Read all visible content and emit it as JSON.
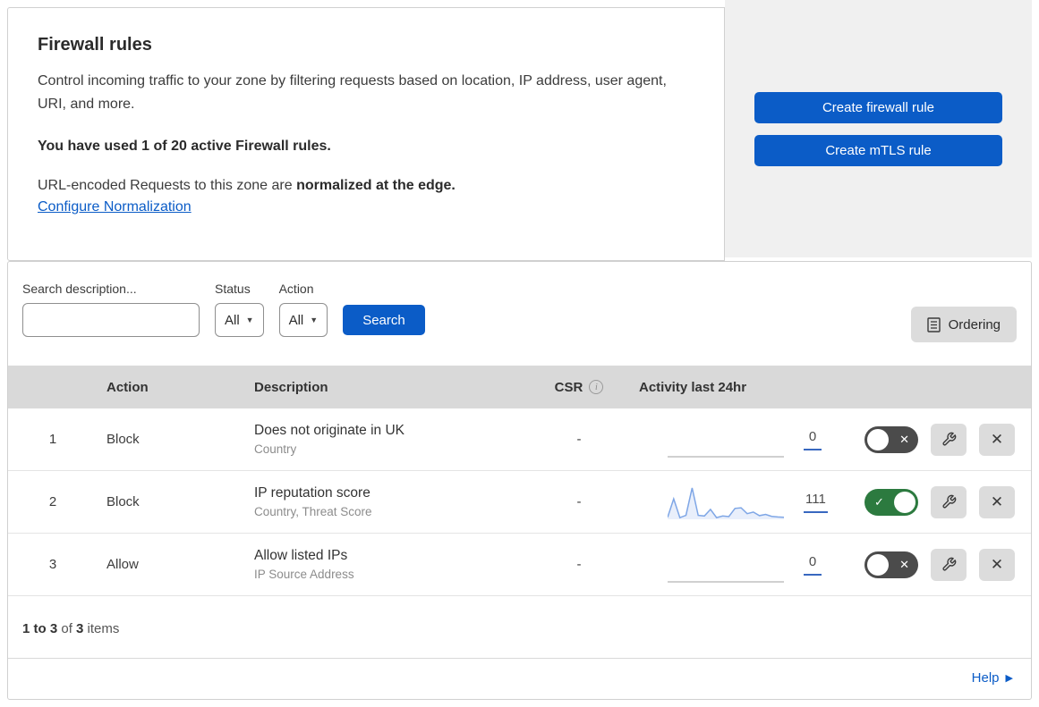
{
  "colors": {
    "primary_blue": "#0b5cc7",
    "panel_gray": "#f0f0f0",
    "table_header_gray": "#d9d9d9",
    "toggle_on_green": "#2c7a3f",
    "toggle_off_gray": "#4b4b4b",
    "sparkline_blue": "#7ea6e6",
    "count_underline_blue": "#3868c0"
  },
  "header": {
    "title": "Firewall rules",
    "description": "Control incoming traffic to your zone by filtering requests based on location, IP address, user agent, URI, and more.",
    "usage": "You have used 1 of 20 active Firewall rules.",
    "normalization_text": "URL-encoded Requests to this zone are ",
    "normalization_bold": "normalized at the edge.",
    "normalization_link": "Configure Normalization",
    "create_firewall_rule_button": "Create firewall rule",
    "create_mtls_rule_button": "Create mTLS rule"
  },
  "filters": {
    "search_label": "Search description...",
    "search_value": "",
    "status_label": "Status",
    "status_value": "All",
    "action_label": "Action",
    "action_value": "All",
    "search_button": "Search",
    "ordering_button": "Ordering"
  },
  "icons": {
    "dropdown_caret": "▼",
    "toggle_check": "✓",
    "toggle_cross": "✕",
    "close_cross": "✕",
    "help_arrow": "▶",
    "csr_info": "i"
  },
  "table": {
    "columns": {
      "action": "Action",
      "description": "Description",
      "csr": "CSR",
      "activity": "Activity last 24hr"
    },
    "rows": [
      {
        "number": "1",
        "action": "Block",
        "description": "Does not originate in UK",
        "fields": "Country",
        "csr": "-",
        "activity_count": "0",
        "enabled": false,
        "sparkline": []
      },
      {
        "number": "2",
        "action": "Block",
        "description": "IP reputation score",
        "fields": "Country, Threat Score",
        "csr": "-",
        "activity_count": "111",
        "enabled": true,
        "sparkline": [
          0.06,
          0.62,
          0.05,
          0.12,
          0.95,
          0.12,
          0.1,
          0.3,
          0.05,
          0.1,
          0.08,
          0.33,
          0.35,
          0.17,
          0.22,
          0.11,
          0.15,
          0.09,
          0.07,
          0.06
        ]
      },
      {
        "number": "3",
        "action": "Allow",
        "description": "Allow listed IPs",
        "fields": "IP Source Address",
        "csr": "-",
        "activity_count": "0",
        "enabled": false,
        "sparkline": []
      }
    ]
  },
  "footer": {
    "range": "1 to 3",
    "of_text": " of ",
    "total": "3",
    "items_text": " items",
    "help_label": "Help"
  }
}
